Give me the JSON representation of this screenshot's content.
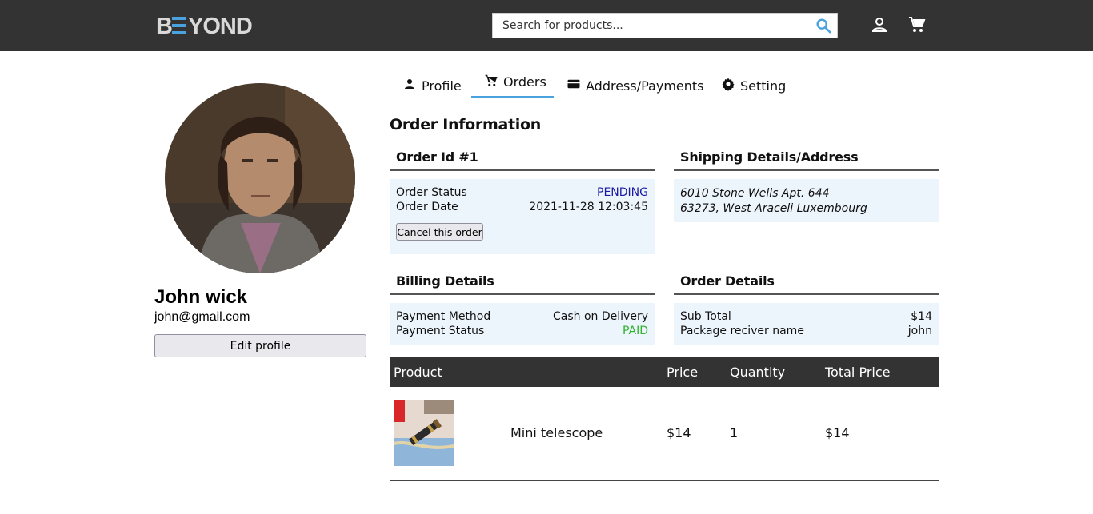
{
  "header": {
    "logo_text": "BEYOND",
    "search": {
      "placeholder": "Search for products...",
      "value": ""
    },
    "icons": [
      "search-icon",
      "account-icon",
      "cart-icon"
    ],
    "colors": {
      "bar": "#333333",
      "accent": "#4aa3df"
    }
  },
  "profile": {
    "name": "John wick",
    "email": "john@gmail.com",
    "edit_label": "Edit profile"
  },
  "tabs": [
    {
      "label": "Profile",
      "icon": "person-icon",
      "active": false
    },
    {
      "label": "Orders",
      "icon": "cart-icon",
      "active": true
    },
    {
      "label": "Address/Payments",
      "icon": "credit-card-icon",
      "active": false
    },
    {
      "label": "Setting",
      "icon": "gear-icon",
      "active": false
    }
  ],
  "order": {
    "section_title": "Order Information",
    "id_title": "Order Id #1",
    "status_label": "Order Status",
    "status_value": "PENDING",
    "date_label": "Order Date",
    "date_value": "2021-11-28 12:03:45",
    "cancel_label": "Cancel this order"
  },
  "shipping": {
    "title": "Shipping Details/Address",
    "line1": "6010 Stone Wells Apt. 644",
    "line2": "63273, West Araceli Luxembourg"
  },
  "billing": {
    "title": "Billing Details",
    "method_label": "Payment Method",
    "method_value": "Cash on Delivery",
    "status_label": "Payment Status",
    "status_value": "PAID"
  },
  "order_details": {
    "title": "Order Details",
    "subtotal_label": "Sub Total",
    "subtotal_value": "$14",
    "receiver_label": "Package reciver name",
    "receiver_value": "john"
  },
  "products": {
    "headers": [
      "Product",
      "Price",
      "Quantity",
      "Total Price"
    ],
    "rows": [
      {
        "name": "Mini telescope",
        "price": "$14",
        "quantity": "1",
        "total": "$14"
      }
    ]
  }
}
